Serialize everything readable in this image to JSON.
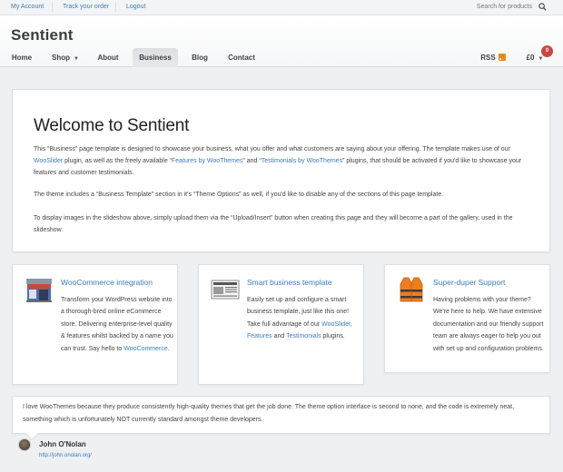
{
  "topbar": {
    "links": [
      "My Account",
      "Track your order",
      "Logout"
    ],
    "search_label": "Search for products"
  },
  "header": {
    "logo": "Sentient",
    "nav": [
      {
        "label": "Home"
      },
      {
        "label": "Shop",
        "has_dropdown": true
      },
      {
        "label": "About"
      },
      {
        "label": "Business",
        "active": true
      },
      {
        "label": "Blog"
      },
      {
        "label": "Contact"
      }
    ],
    "rss_label": "RSS",
    "cart_total": "£0",
    "cart_count": "0"
  },
  "welcome": {
    "title": "Welcome to Sentient",
    "p1_a": "This “Business” page template is designed to showcase your business, what you offer and what customers are saying about your offering. The template makes use of our ",
    "p1_link1": "WooSlider",
    "p1_b": " plugin, as well as the freely available “",
    "p1_link2": "Features by WooThemes",
    "p1_c": "” and “",
    "p1_link3": "Testimonials by WooThemes",
    "p1_d": "” plugins, that should be activated if you'd like to showcase your features and customer testimonials.",
    "p2": "The theme includes a “Business Template” section in it's “Theme Options” as well, if you'd like to disable any of the sections of this page template.",
    "p3": "To display images in the slideshow above, simply upload them via the “Upload/Insert” button when creating this page and they will become a part of the gallery, used in the slideshow."
  },
  "features": [
    {
      "title": "WooCommerce integration",
      "icon": "storefront-icon",
      "text_a": "Transform your WordPress website into a thorough-bred online eCommerce store. Delivering enterprise-level quality & features whilst backed by a name you can trust. Say hello to ",
      "link": "WooCommerce",
      "text_b": "."
    },
    {
      "title": "Smart business template",
      "icon": "newspaper-icon",
      "text_a": "Easily set up and configure a smart business template, just like this one! Take full advantage of our ",
      "link1": "WooSlider",
      "text_b": ", ",
      "link2": "Features",
      "text_c": " and ",
      "link3": "Testimonials",
      "text_d": " plugins."
    },
    {
      "title": "Super-duper Support",
      "icon": "life-vest-icon",
      "text_a": "Having problems with your theme? We're here to help. We have extensive documentation and our friendly support team are always eager to help you out with set up and configuration problems."
    }
  ],
  "testimonial": {
    "quote": "I love WooThemes because they produce consistently high-quality themes that get the job done. The theme option interface is second to none, and the code is extremely neat, something which is unfortunately NOT currently standard amongst theme developers.",
    "author": "John O'Nolan",
    "url": "http://john.onolan.org/"
  },
  "colors": {
    "link": "#3b7dbf",
    "background": "#eef0f2",
    "rss": "#f0861c",
    "badge": "#c94840"
  }
}
